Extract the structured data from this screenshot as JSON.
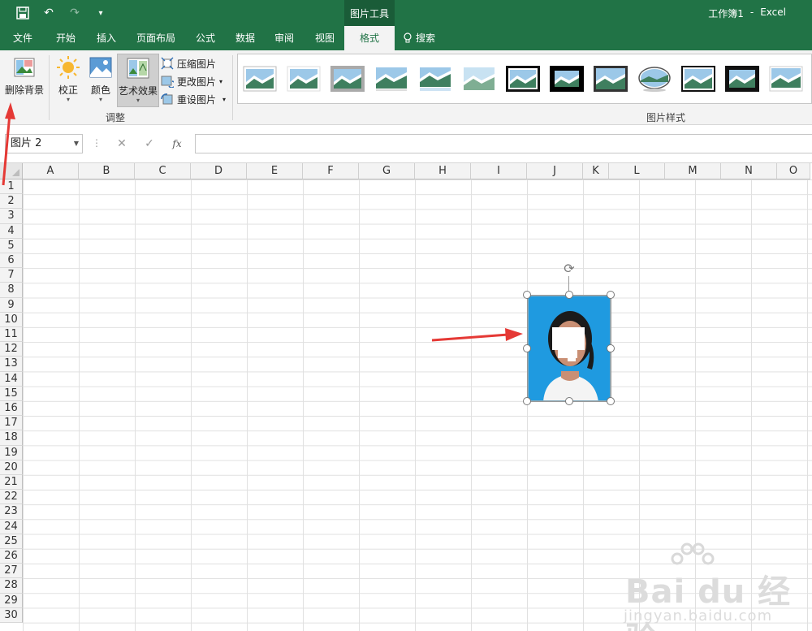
{
  "titlebar": {
    "context_tab_title": "图片工具",
    "doc_name": "工作簿1",
    "separator": "-",
    "app_name": "Excel"
  },
  "tabs": [
    {
      "label": "文件"
    },
    {
      "label": "开始"
    },
    {
      "label": "插入"
    },
    {
      "label": "页面布局"
    },
    {
      "label": "公式"
    },
    {
      "label": "数据"
    },
    {
      "label": "审阅"
    },
    {
      "label": "视图"
    },
    {
      "label": "格式",
      "active": true
    }
  ],
  "search": {
    "label": "搜索"
  },
  "ribbon": {
    "remove_background": "删除背景",
    "corrections": "校正",
    "color": "颜色",
    "artistic_effects": "艺术效果",
    "compress": "压缩图片",
    "change_picture": "更改图片",
    "reset_picture": "重设图片",
    "group_adjust": "调整",
    "group_styles": "图片样式"
  },
  "formula_bar": {
    "name_box": "图片 2",
    "cancel": "✕",
    "enter": "✓",
    "fx": "fx",
    "formula": ""
  },
  "columns": [
    "A",
    "B",
    "C",
    "D",
    "E",
    "F",
    "G",
    "H",
    "I",
    "J",
    "K",
    "L",
    "M",
    "N",
    "O"
  ],
  "rows": [
    "1",
    "2",
    "3",
    "4",
    "5",
    "6",
    "7",
    "8",
    "9",
    "10",
    "11",
    "12",
    "13",
    "14",
    "15",
    "16",
    "17",
    "18",
    "19",
    "20",
    "21",
    "22",
    "23",
    "24",
    "25",
    "26",
    "27",
    "28",
    "29",
    "30"
  ],
  "watermark": {
    "main": "Bai du 经验",
    "sub": "jingyan.baidu.com"
  },
  "colors": {
    "excel_green": "#217346",
    "arrow_red": "#e53935",
    "photo_blue": "#1f9ae0"
  }
}
